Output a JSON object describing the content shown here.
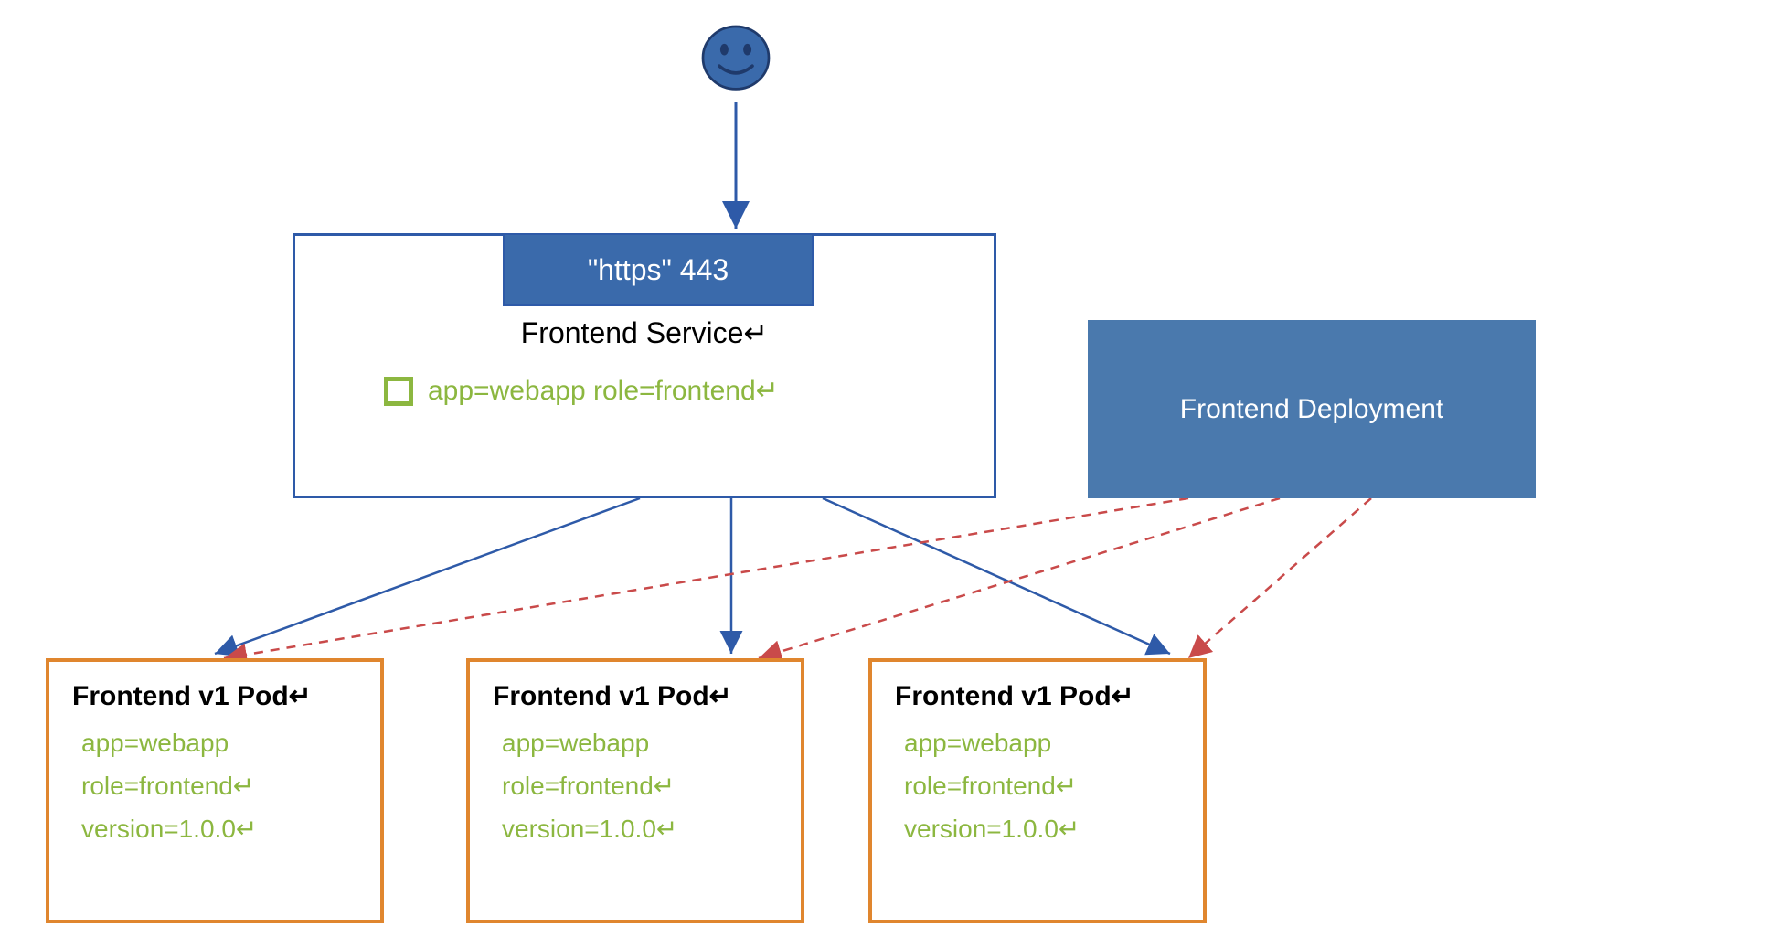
{
  "user": {
    "icon_name": "smiley-icon"
  },
  "service": {
    "port_label": "\"https\" 443",
    "title": "Frontend Service↵",
    "selector": "app=webapp role=frontend↵"
  },
  "deployment": {
    "title": "Frontend Deployment"
  },
  "pods": [
    {
      "title": "Frontend v1 Pod↵",
      "labels": [
        "app=webapp",
        "role=frontend↵",
        "version=1.0.0↵"
      ]
    },
    {
      "title": "Frontend v1 Pod↵",
      "labels": [
        "app=webapp",
        "role=frontend↵",
        "version=1.0.0↵"
      ]
    },
    {
      "title": "Frontend v1 Pod↵",
      "labels": [
        "app=webapp",
        "role=frontend↵",
        "version=1.0.0↵"
      ]
    }
  ],
  "colors": {
    "blue_dark": "#2e5aa8",
    "blue_fill": "#3a6aab",
    "blue_deploy": "#4a79ad",
    "green": "#8cb740",
    "orange": "#e0862e",
    "red_dash": "#c94a4a"
  }
}
